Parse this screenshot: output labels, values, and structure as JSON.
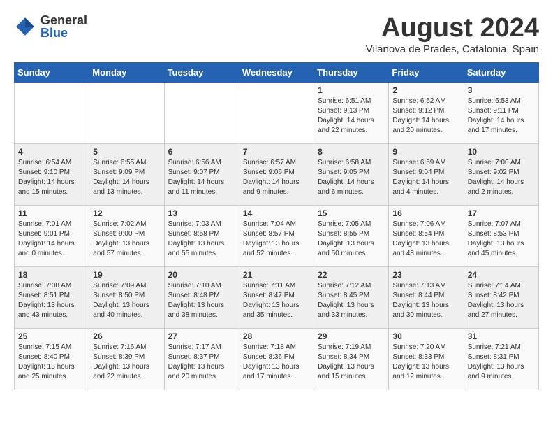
{
  "logo": {
    "general": "General",
    "blue": "Blue"
  },
  "header": {
    "month_year": "August 2024",
    "location": "Vilanova de Prades, Catalonia, Spain"
  },
  "weekdays": [
    "Sunday",
    "Monday",
    "Tuesday",
    "Wednesday",
    "Thursday",
    "Friday",
    "Saturday"
  ],
  "weeks": [
    [
      {
        "day": "",
        "sunrise": "",
        "sunset": "",
        "daylight": ""
      },
      {
        "day": "",
        "sunrise": "",
        "sunset": "",
        "daylight": ""
      },
      {
        "day": "",
        "sunrise": "",
        "sunset": "",
        "daylight": ""
      },
      {
        "day": "",
        "sunrise": "",
        "sunset": "",
        "daylight": ""
      },
      {
        "day": "1",
        "sunrise": "6:51 AM",
        "sunset": "9:13 PM",
        "daylight": "14 hours and 22 minutes."
      },
      {
        "day": "2",
        "sunrise": "6:52 AM",
        "sunset": "9:12 PM",
        "daylight": "14 hours and 20 minutes."
      },
      {
        "day": "3",
        "sunrise": "6:53 AM",
        "sunset": "9:11 PM",
        "daylight": "14 hours and 17 minutes."
      }
    ],
    [
      {
        "day": "4",
        "sunrise": "6:54 AM",
        "sunset": "9:10 PM",
        "daylight": "14 hours and 15 minutes."
      },
      {
        "day": "5",
        "sunrise": "6:55 AM",
        "sunset": "9:09 PM",
        "daylight": "14 hours and 13 minutes."
      },
      {
        "day": "6",
        "sunrise": "6:56 AM",
        "sunset": "9:07 PM",
        "daylight": "14 hours and 11 minutes."
      },
      {
        "day": "7",
        "sunrise": "6:57 AM",
        "sunset": "9:06 PM",
        "daylight": "14 hours and 9 minutes."
      },
      {
        "day": "8",
        "sunrise": "6:58 AM",
        "sunset": "9:05 PM",
        "daylight": "14 hours and 6 minutes."
      },
      {
        "day": "9",
        "sunrise": "6:59 AM",
        "sunset": "9:04 PM",
        "daylight": "14 hours and 4 minutes."
      },
      {
        "day": "10",
        "sunrise": "7:00 AM",
        "sunset": "9:02 PM",
        "daylight": "14 hours and 2 minutes."
      }
    ],
    [
      {
        "day": "11",
        "sunrise": "7:01 AM",
        "sunset": "9:01 PM",
        "daylight": "14 hours and 0 minutes."
      },
      {
        "day": "12",
        "sunrise": "7:02 AM",
        "sunset": "9:00 PM",
        "daylight": "13 hours and 57 minutes."
      },
      {
        "day": "13",
        "sunrise": "7:03 AM",
        "sunset": "8:58 PM",
        "daylight": "13 hours and 55 minutes."
      },
      {
        "day": "14",
        "sunrise": "7:04 AM",
        "sunset": "8:57 PM",
        "daylight": "13 hours and 52 minutes."
      },
      {
        "day": "15",
        "sunrise": "7:05 AM",
        "sunset": "8:55 PM",
        "daylight": "13 hours and 50 minutes."
      },
      {
        "day": "16",
        "sunrise": "7:06 AM",
        "sunset": "8:54 PM",
        "daylight": "13 hours and 48 minutes."
      },
      {
        "day": "17",
        "sunrise": "7:07 AM",
        "sunset": "8:53 PM",
        "daylight": "13 hours and 45 minutes."
      }
    ],
    [
      {
        "day": "18",
        "sunrise": "7:08 AM",
        "sunset": "8:51 PM",
        "daylight": "13 hours and 43 minutes."
      },
      {
        "day": "19",
        "sunrise": "7:09 AM",
        "sunset": "8:50 PM",
        "daylight": "13 hours and 40 minutes."
      },
      {
        "day": "20",
        "sunrise": "7:10 AM",
        "sunset": "8:48 PM",
        "daylight": "13 hours and 38 minutes."
      },
      {
        "day": "21",
        "sunrise": "7:11 AM",
        "sunset": "8:47 PM",
        "daylight": "13 hours and 35 minutes."
      },
      {
        "day": "22",
        "sunrise": "7:12 AM",
        "sunset": "8:45 PM",
        "daylight": "13 hours and 33 minutes."
      },
      {
        "day": "23",
        "sunrise": "7:13 AM",
        "sunset": "8:44 PM",
        "daylight": "13 hours and 30 minutes."
      },
      {
        "day": "24",
        "sunrise": "7:14 AM",
        "sunset": "8:42 PM",
        "daylight": "13 hours and 27 minutes."
      }
    ],
    [
      {
        "day": "25",
        "sunrise": "7:15 AM",
        "sunset": "8:40 PM",
        "daylight": "13 hours and 25 minutes."
      },
      {
        "day": "26",
        "sunrise": "7:16 AM",
        "sunset": "8:39 PM",
        "daylight": "13 hours and 22 minutes."
      },
      {
        "day": "27",
        "sunrise": "7:17 AM",
        "sunset": "8:37 PM",
        "daylight": "13 hours and 20 minutes."
      },
      {
        "day": "28",
        "sunrise": "7:18 AM",
        "sunset": "8:36 PM",
        "daylight": "13 hours and 17 minutes."
      },
      {
        "day": "29",
        "sunrise": "7:19 AM",
        "sunset": "8:34 PM",
        "daylight": "13 hours and 15 minutes."
      },
      {
        "day": "30",
        "sunrise": "7:20 AM",
        "sunset": "8:33 PM",
        "daylight": "13 hours and 12 minutes."
      },
      {
        "day": "31",
        "sunrise": "7:21 AM",
        "sunset": "8:31 PM",
        "daylight": "13 hours and 9 minutes."
      }
    ]
  ]
}
